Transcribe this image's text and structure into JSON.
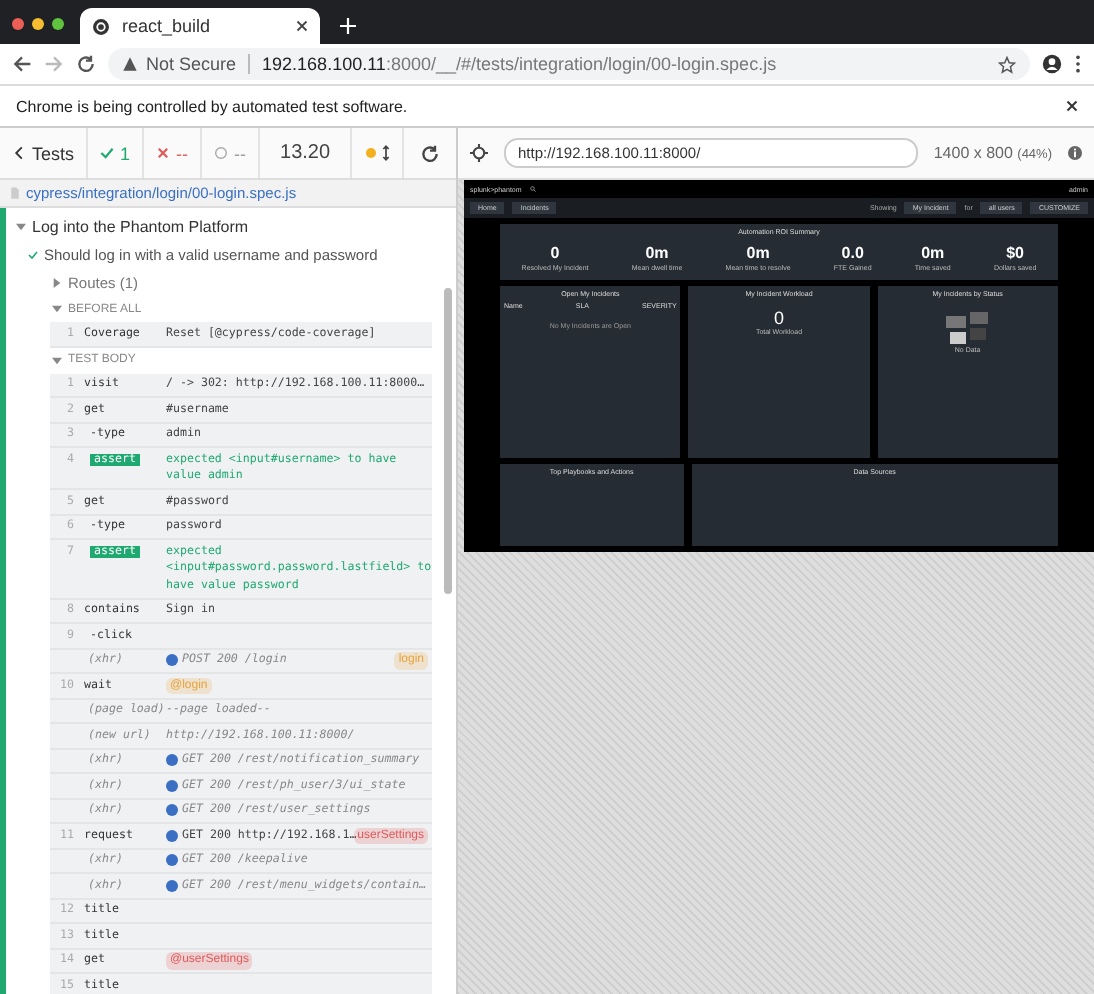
{
  "browser": {
    "tab_title": "react_build",
    "security": "Not Secure",
    "url_host": "192.168.100.11",
    "url_rest": ":8000/__/#/tests/integration/login/00-login.spec.js",
    "infobar": "Chrome is being controlled by automated test software."
  },
  "runner": {
    "back": "Tests",
    "passed": "1",
    "failed": "--",
    "pending": "--",
    "duration": "13.20",
    "running": true,
    "spec_path": "cypress/integration/login/00-login.spec.js",
    "suite": {
      "title": "Log into the Phantom Platform",
      "expanded": true
    },
    "test": {
      "title": "Should log in with a valid username and password",
      "passed": true
    },
    "routes": {
      "label": "Routes (1)",
      "expanded": false
    },
    "hooks": [
      {
        "label": "BEFORE ALL",
        "expanded": true,
        "commands": [
          {
            "kind": "command",
            "number": "1",
            "name": "Coverage",
            "message": "Reset [@cypress/code-coverage]"
          }
        ]
      },
      {
        "label": "TEST BODY",
        "expanded": true,
        "commands": [
          {
            "kind": "command",
            "number": "1",
            "name": "visit",
            "message": "/ -> 302: http://192.168.100.11:8000…"
          },
          {
            "kind": "command",
            "number": "2",
            "name": "get",
            "message": "#username"
          },
          {
            "kind": "child",
            "number": "3",
            "name": "-type",
            "message": "admin"
          },
          {
            "kind": "assert",
            "number": "4",
            "name": "assert",
            "message": "expected <input#username> to have value admin"
          },
          {
            "kind": "command",
            "number": "5",
            "name": "get",
            "message": "#password"
          },
          {
            "kind": "child",
            "number": "6",
            "name": "-type",
            "message": "password"
          },
          {
            "kind": "assert",
            "number": "7",
            "name": "assert",
            "message": "expected <input#password.password.lastfield> to have value password"
          },
          {
            "kind": "command",
            "number": "8",
            "name": "contains",
            "message": "Sign in"
          },
          {
            "kind": "child",
            "number": "9",
            "name": "-click"
          },
          {
            "kind": "event",
            "name": "(xhr)",
            "message": "POST 200 /login",
            "dot": true,
            "alias": {
              "text": "login",
              "color": "#e8a33a"
            }
          },
          {
            "kind": "command",
            "number": "10",
            "name": "wait",
            "badge": {
              "text": "@login",
              "color": "#e8a33a"
            }
          },
          {
            "kind": "event",
            "name": "(page load)",
            "message": "--page loaded--"
          },
          {
            "kind": "event",
            "name": "(new url)",
            "message": "http://192.168.100.11:8000/"
          },
          {
            "kind": "event",
            "name": "(xhr)",
            "message": "GET 200 /rest/notification_summary",
            "dot": true
          },
          {
            "kind": "event",
            "name": "(xhr)",
            "message": "GET 200 /rest/ph_user/3/ui_state",
            "dot": true
          },
          {
            "kind": "event",
            "name": "(xhr)",
            "message": "GET 200 /rest/user_settings",
            "dot": true
          },
          {
            "kind": "command",
            "number": "11",
            "name": "request",
            "message": "GET 200 http://192.168.1…",
            "dot": true,
            "alias": {
              "text": "userSettings",
              "color": "#e05a5a"
            }
          },
          {
            "kind": "event",
            "name": "(xhr)",
            "message": "GET 200 /keepalive",
            "dot": true
          },
          {
            "kind": "event",
            "name": "(xhr)",
            "message": "GET 200 /rest/menu_widgets/contain…",
            "dot": true
          },
          {
            "kind": "command",
            "number": "12",
            "name": "title"
          },
          {
            "kind": "command",
            "number": "13",
            "name": "title"
          },
          {
            "kind": "command",
            "number": "14",
            "name": "get",
            "badge": {
              "text": "@userSettings",
              "color": "#e05a5a"
            }
          },
          {
            "kind": "command",
            "number": "15",
            "name": "title"
          }
        ]
      }
    ]
  },
  "viewport": {
    "url": "http://192.168.100.11:8000/",
    "size": "1400 x 800",
    "scale": "(44%)"
  },
  "app": {
    "brand": "splunk>phantom",
    "user": "admin",
    "filters": [
      "Home",
      "Incidents"
    ],
    "showing": "Showing",
    "scope": "My Incident",
    "for": "for",
    "users": "all users",
    "customize": "CUSTOMIZE",
    "roi_title": "Automation ROI Summary",
    "metrics": [
      {
        "value": "0",
        "label": "Resolved My Incident"
      },
      {
        "value": "0m",
        "label": "Mean dwell time"
      },
      {
        "value": "0m",
        "label": "Mean time to resolve"
      },
      {
        "value": "0.0",
        "label": "FTE Gained"
      },
      {
        "value": "0m",
        "label": "Time saved"
      },
      {
        "value": "$0",
        "label": "Dollars saved"
      }
    ],
    "panels": [
      {
        "kind": "table",
        "title": "Open My Incidents",
        "columns": [
          "Name",
          "SLA",
          "SEVERITY"
        ],
        "empty": "No My Incidents are Open"
      },
      {
        "kind": "number",
        "title": "My Incident Workload",
        "value": "0",
        "label": "Total Workload"
      },
      {
        "kind": "nodata",
        "title": "My Incidents by Status",
        "label": "No Data"
      }
    ],
    "bottom_panels": [
      "Top Playbooks and Actions",
      "Data Sources"
    ]
  }
}
